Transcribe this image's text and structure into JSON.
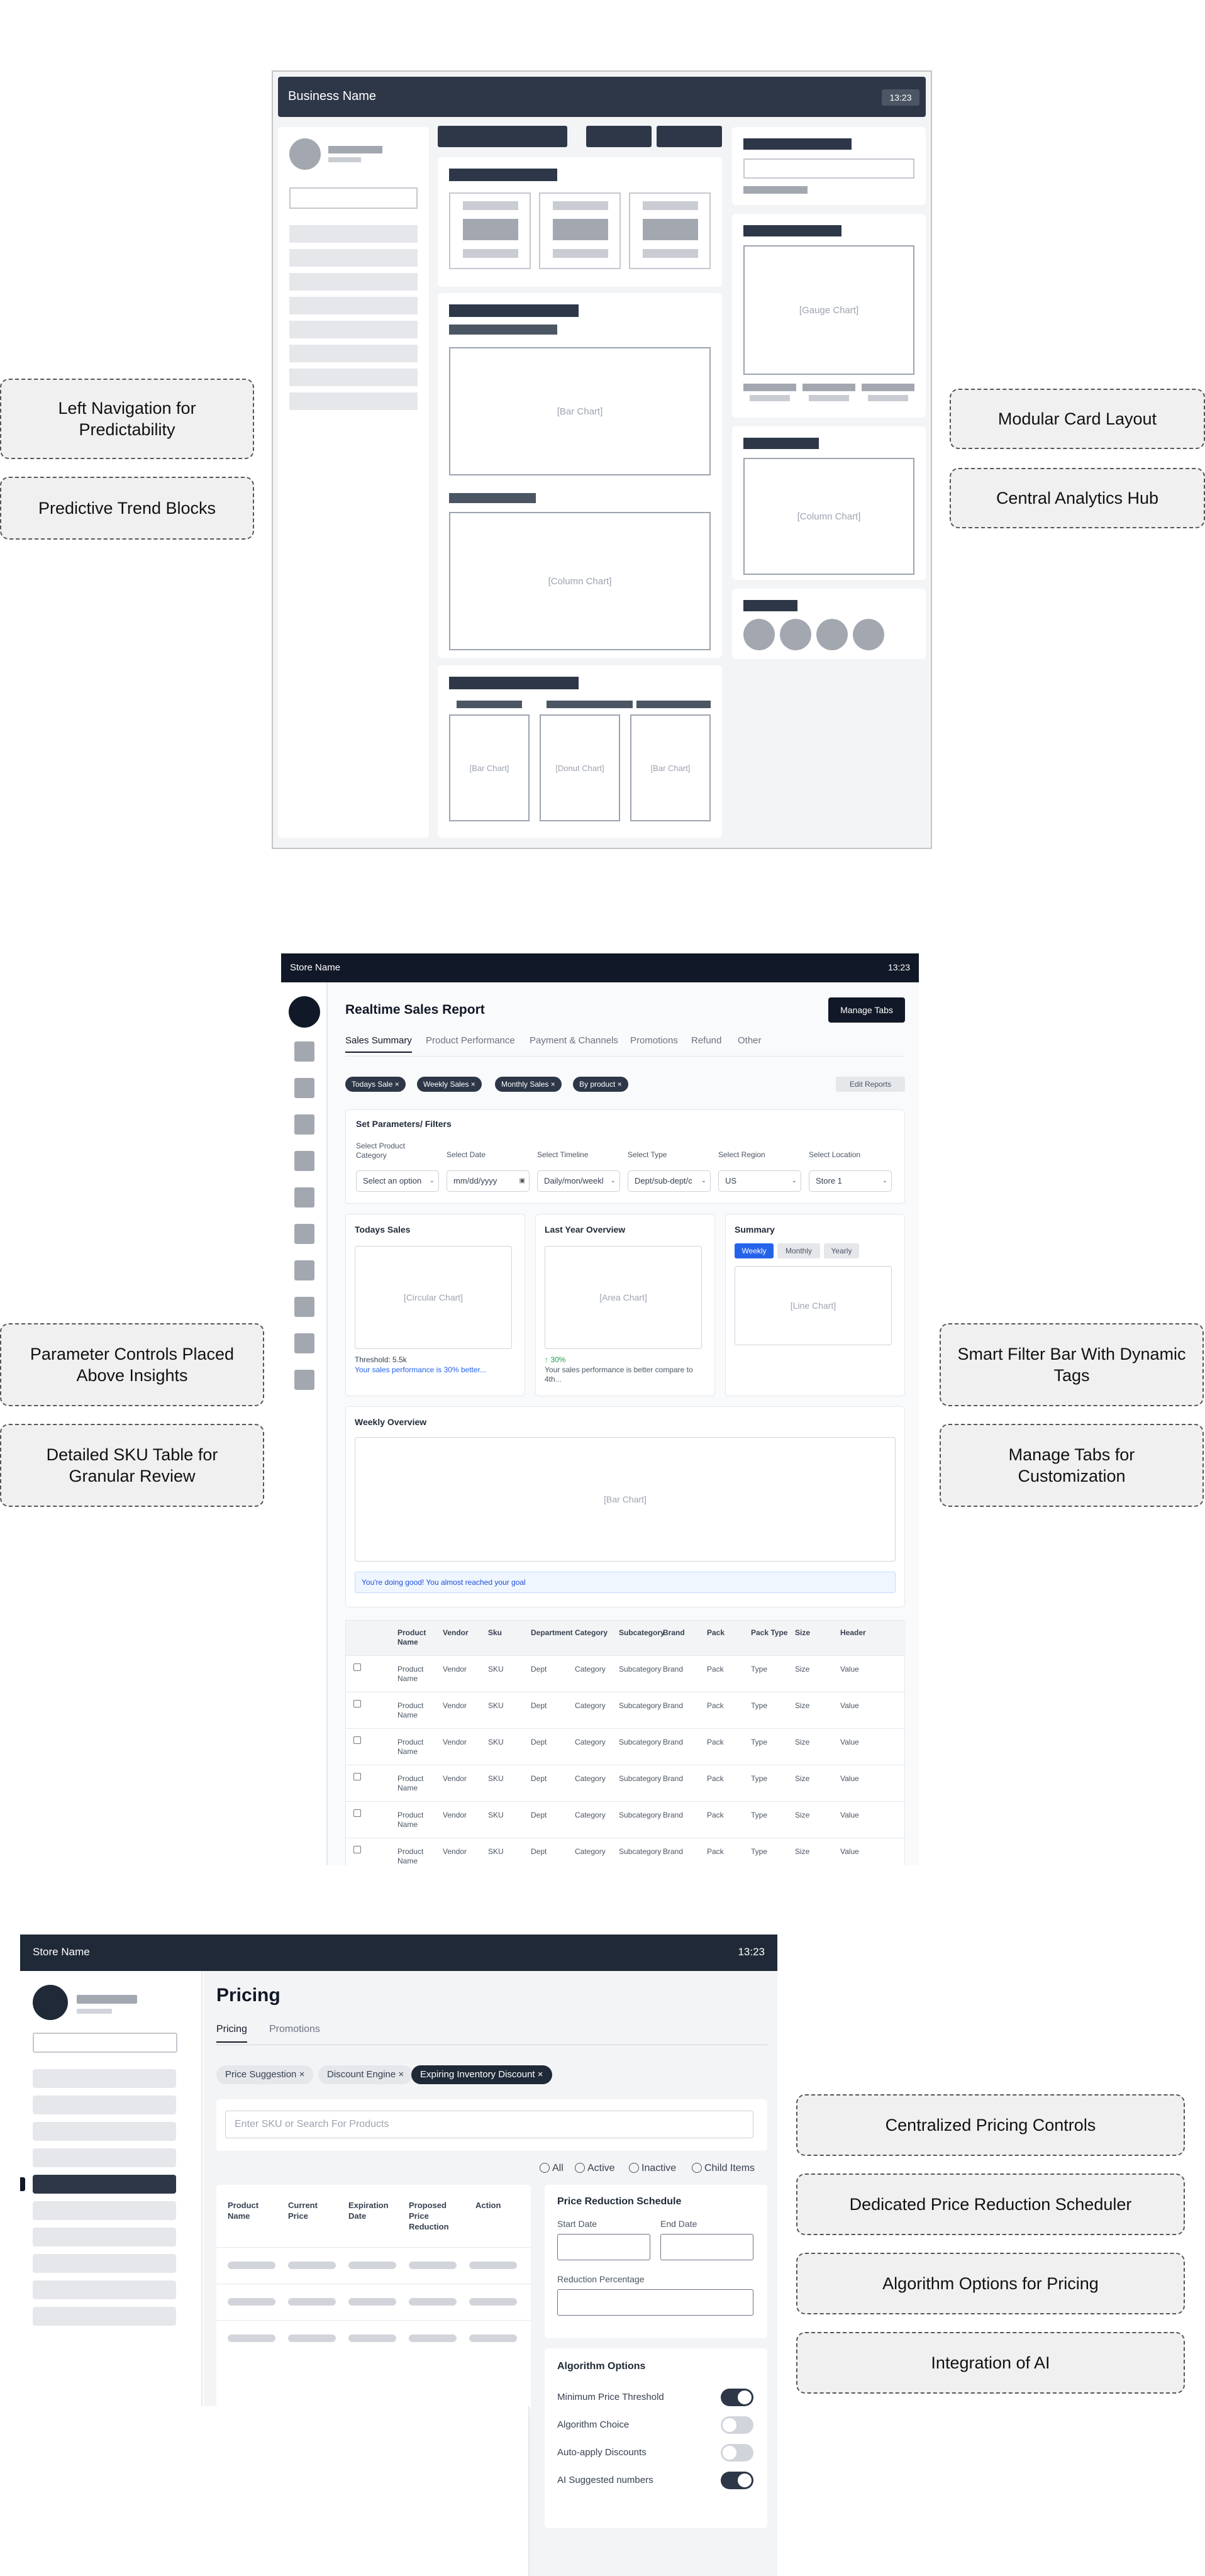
{
  "callouts": {
    "left_nav": "Left Navigation for Predictability",
    "predictive": "Predictive Trend Blocks",
    "modular": "Modular Card Layout",
    "central": "Central Analytics Hub",
    "parameter": "Parameter Controls Placed Above Insights",
    "sku_table": "Detailed SKU Table for Granular Review",
    "smart_filter": "Smart Filter Bar With Dynamic Tags",
    "manage_tabs": "Manage Tabs for Customization",
    "centralized": "Centralized Pricing Controls",
    "scheduler": "Dedicated Price Reduction Scheduler",
    "algorithm": "Algorithm Options for Pricing",
    "ai": "Integration of AI"
  },
  "wireframe1": {
    "title": "Business Name",
    "time": "13:23",
    "placeholders": {
      "bar1": "[Bar Chart]",
      "column1": "[Column Chart]",
      "bar2": "[Bar Chart]",
      "donut": "[Donut Chart]",
      "bar3": "[Bar Chart]",
      "gauge": "[Gauge Chart]",
      "column2": "[Column Chart]"
    }
  },
  "wireframe2": {
    "store": "Store Name",
    "time": "13:23",
    "title": "Realtime Sales Report",
    "manage_tabs": "Manage Tabs",
    "tabs": [
      "Sales Summary",
      "Product Performance",
      "Payment & Channels",
      "Promotions",
      "Refund",
      "Other"
    ],
    "chips": [
      "Todays Sale ×",
      "Weekly Sales ×",
      "Monthly Sales ×",
      "By product ×"
    ],
    "edit_reports": "Edit Reports",
    "filters_title": "Set Parameters/ Filters",
    "filters": [
      {
        "label": "Select Product Category",
        "value": "Select an option"
      },
      {
        "label": "Select Date",
        "value": "mm/dd/yyyy"
      },
      {
        "label": "Select Timeline",
        "value": "Daily/mon/weekl"
      },
      {
        "label": "Select Type",
        "value": "Dept/sub-dept/c"
      },
      {
        "label": "Select Region",
        "value": "US"
      },
      {
        "label": "Select Location",
        "value": "Store 1"
      }
    ],
    "todays_sales": {
      "title": "Todays Sales",
      "chart": "[Circular Chart]",
      "threshold": "Threshold: 5.5k",
      "note": "Your sales performance is 30% better..."
    },
    "last_year": {
      "title": "Last Year Overview",
      "chart": "[Area Chart]",
      "delta": "↑ 30%",
      "note": "Your sales performance is better compare to 4th..."
    },
    "summary": {
      "title": "Summary",
      "segments": [
        "Weekly",
        "Monthly",
        "Yearly"
      ],
      "chart": "[Line Chart]"
    },
    "weekly": {
      "title": "Weekly Overview",
      "chart": "[Bar Chart]",
      "message": "You're doing good! You almost reached your goal"
    },
    "table": {
      "headers": [
        "Product Name",
        "Vendor",
        "Sku",
        "Department",
        "Category",
        "Subcategory",
        "Brand",
        "Pack",
        "Pack Type",
        "Size",
        "Header"
      ],
      "row": [
        "Product Name",
        "Vendor",
        "SKU",
        "Dept",
        "Category",
        "Subcategory",
        "Brand",
        "Pack",
        "Type",
        "Size",
        "Value"
      ],
      "row_count": 6
    }
  },
  "wireframe3": {
    "store": "Store Name",
    "time": "13:23",
    "title": "Pricing",
    "tabs": [
      "Pricing",
      "Promotions"
    ],
    "chips": [
      "Price Suggestion ×",
      "Discount Engine ×",
      "Expiring Inventory Discount ×"
    ],
    "search_placeholder": "Enter SKU or Search For Products",
    "filters": [
      "All",
      "Active",
      "Inactive",
      "Child Items"
    ],
    "table_headers": [
      "Product Name",
      "Current Price",
      "Expiration Date",
      "Proposed Price Reduction",
      "Action"
    ],
    "schedule": {
      "title": "Price Reduction Schedule",
      "start": "Start Date",
      "end": "End Date",
      "percent": "Reduction Percentage"
    },
    "algorithm": {
      "title": "Algorithm Options",
      "options": [
        {
          "label": "Minimum Price Threshold",
          "on": true
        },
        {
          "label": "Algorithm Choice",
          "on": false
        },
        {
          "label": "Auto-apply Discounts",
          "on": false
        },
        {
          "label": "AI Suggested numbers",
          "on": true
        }
      ]
    }
  }
}
